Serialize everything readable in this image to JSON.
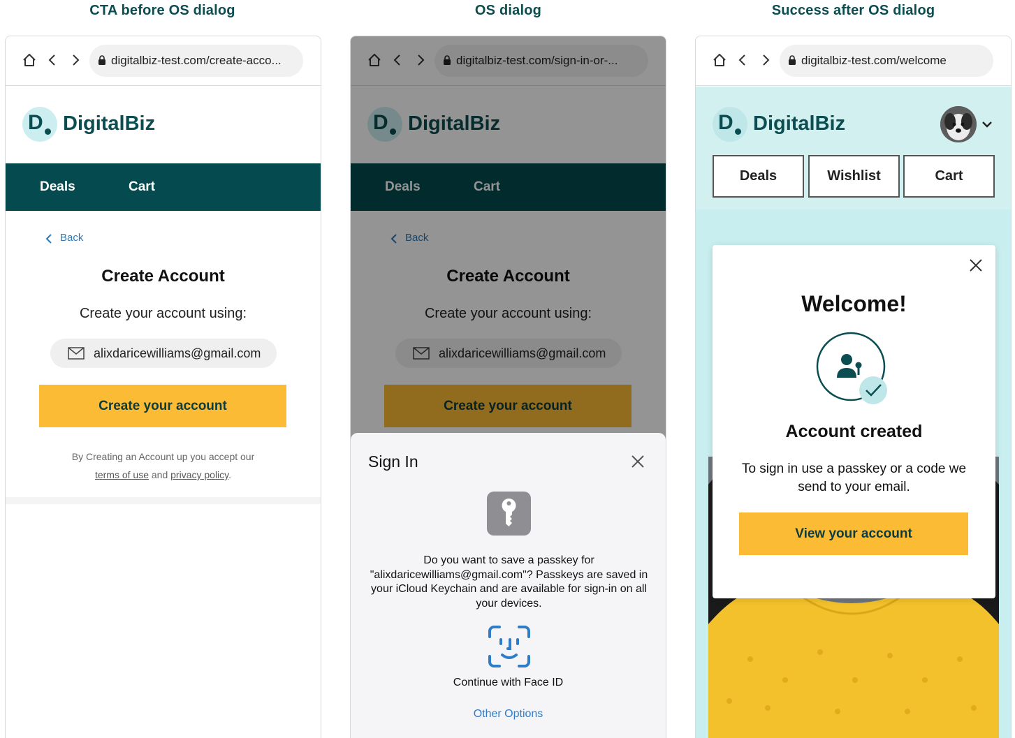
{
  "columns": [
    {
      "title": "CTA before OS dialog",
      "url": "digitalbiz-test.com/create-acco...",
      "brand": "DigitalBiz",
      "logo_letter": "D",
      "nav": [
        "Deals",
        "Cart"
      ],
      "back": "Back",
      "heading": "Create Account",
      "subheading": "Create your account using:",
      "email": "alixdaricewilliams@gmail.com",
      "cta": "Create your account",
      "legal_prefix": "By Creating an Account up you accept our",
      "terms": "terms of use",
      "legal_and": "and",
      "privacy": "privacy policy",
      "legal_end": "."
    },
    {
      "title": "OS dialog",
      "url": "digitalbiz-test.com/sign-in-or-...",
      "sheet": {
        "title": "Sign In",
        "message": "Do you want to save a passkey for \"alixdaricewilliams@gmail.com\"? Passkeys are saved in your iCloud Keychain and are available for sign-in on all your devices.",
        "face_id": "Continue with Face ID",
        "other_options": "Other Options"
      }
    },
    {
      "title": "Success after OS dialog",
      "url": "digitalbiz-test.com/welcome",
      "tabs": [
        "Deals",
        "Wishlist",
        "Cart"
      ],
      "modal": {
        "title": "Welcome!",
        "heading": "Account created",
        "message": "To sign in use a passkey or a code we send to your email.",
        "cta": "View your account"
      }
    }
  ],
  "colors": {
    "brand_teal": "#0b4d50",
    "nav_bar": "#044a4e",
    "cta_yellow": "#fcbb35",
    "link_blue": "#2f78b6",
    "light_teal": "#d3f0f1"
  },
  "icons": [
    "home-icon",
    "back-arrow-icon",
    "forward-arrow-icon",
    "lock-icon",
    "mail-icon",
    "close-icon",
    "passkey-icon",
    "face-id-icon",
    "account-created-icon",
    "chevron-down-icon"
  ]
}
